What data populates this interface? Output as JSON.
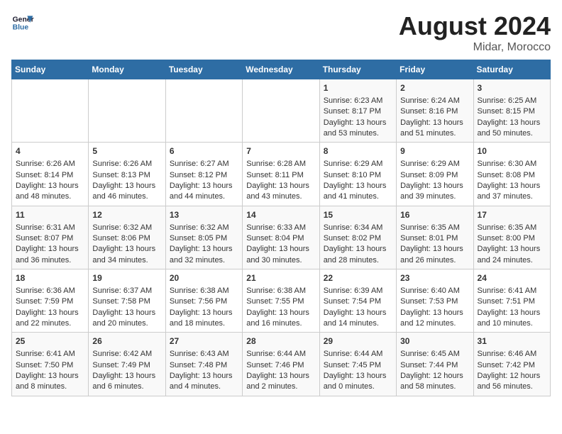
{
  "header": {
    "logo_line1": "General",
    "logo_line2": "Blue",
    "month_year": "August 2024",
    "location": "Midar, Morocco"
  },
  "days_of_week": [
    "Sunday",
    "Monday",
    "Tuesday",
    "Wednesday",
    "Thursday",
    "Friday",
    "Saturday"
  ],
  "weeks": [
    [
      {
        "day": "",
        "info": ""
      },
      {
        "day": "",
        "info": ""
      },
      {
        "day": "",
        "info": ""
      },
      {
        "day": "",
        "info": ""
      },
      {
        "day": "1",
        "info": "Sunrise: 6:23 AM\nSunset: 8:17 PM\nDaylight: 13 hours\nand 53 minutes."
      },
      {
        "day": "2",
        "info": "Sunrise: 6:24 AM\nSunset: 8:16 PM\nDaylight: 13 hours\nand 51 minutes."
      },
      {
        "day": "3",
        "info": "Sunrise: 6:25 AM\nSunset: 8:15 PM\nDaylight: 13 hours\nand 50 minutes."
      }
    ],
    [
      {
        "day": "4",
        "info": "Sunrise: 6:26 AM\nSunset: 8:14 PM\nDaylight: 13 hours\nand 48 minutes."
      },
      {
        "day": "5",
        "info": "Sunrise: 6:26 AM\nSunset: 8:13 PM\nDaylight: 13 hours\nand 46 minutes."
      },
      {
        "day": "6",
        "info": "Sunrise: 6:27 AM\nSunset: 8:12 PM\nDaylight: 13 hours\nand 44 minutes."
      },
      {
        "day": "7",
        "info": "Sunrise: 6:28 AM\nSunset: 8:11 PM\nDaylight: 13 hours\nand 43 minutes."
      },
      {
        "day": "8",
        "info": "Sunrise: 6:29 AM\nSunset: 8:10 PM\nDaylight: 13 hours\nand 41 minutes."
      },
      {
        "day": "9",
        "info": "Sunrise: 6:29 AM\nSunset: 8:09 PM\nDaylight: 13 hours\nand 39 minutes."
      },
      {
        "day": "10",
        "info": "Sunrise: 6:30 AM\nSunset: 8:08 PM\nDaylight: 13 hours\nand 37 minutes."
      }
    ],
    [
      {
        "day": "11",
        "info": "Sunrise: 6:31 AM\nSunset: 8:07 PM\nDaylight: 13 hours\nand 36 minutes."
      },
      {
        "day": "12",
        "info": "Sunrise: 6:32 AM\nSunset: 8:06 PM\nDaylight: 13 hours\nand 34 minutes."
      },
      {
        "day": "13",
        "info": "Sunrise: 6:32 AM\nSunset: 8:05 PM\nDaylight: 13 hours\nand 32 minutes."
      },
      {
        "day": "14",
        "info": "Sunrise: 6:33 AM\nSunset: 8:04 PM\nDaylight: 13 hours\nand 30 minutes."
      },
      {
        "day": "15",
        "info": "Sunrise: 6:34 AM\nSunset: 8:02 PM\nDaylight: 13 hours\nand 28 minutes."
      },
      {
        "day": "16",
        "info": "Sunrise: 6:35 AM\nSunset: 8:01 PM\nDaylight: 13 hours\nand 26 minutes."
      },
      {
        "day": "17",
        "info": "Sunrise: 6:35 AM\nSunset: 8:00 PM\nDaylight: 13 hours\nand 24 minutes."
      }
    ],
    [
      {
        "day": "18",
        "info": "Sunrise: 6:36 AM\nSunset: 7:59 PM\nDaylight: 13 hours\nand 22 minutes."
      },
      {
        "day": "19",
        "info": "Sunrise: 6:37 AM\nSunset: 7:58 PM\nDaylight: 13 hours\nand 20 minutes."
      },
      {
        "day": "20",
        "info": "Sunrise: 6:38 AM\nSunset: 7:56 PM\nDaylight: 13 hours\nand 18 minutes."
      },
      {
        "day": "21",
        "info": "Sunrise: 6:38 AM\nSunset: 7:55 PM\nDaylight: 13 hours\nand 16 minutes."
      },
      {
        "day": "22",
        "info": "Sunrise: 6:39 AM\nSunset: 7:54 PM\nDaylight: 13 hours\nand 14 minutes."
      },
      {
        "day": "23",
        "info": "Sunrise: 6:40 AM\nSunset: 7:53 PM\nDaylight: 13 hours\nand 12 minutes."
      },
      {
        "day": "24",
        "info": "Sunrise: 6:41 AM\nSunset: 7:51 PM\nDaylight: 13 hours\nand 10 minutes."
      }
    ],
    [
      {
        "day": "25",
        "info": "Sunrise: 6:41 AM\nSunset: 7:50 PM\nDaylight: 13 hours\nand 8 minutes."
      },
      {
        "day": "26",
        "info": "Sunrise: 6:42 AM\nSunset: 7:49 PM\nDaylight: 13 hours\nand 6 minutes."
      },
      {
        "day": "27",
        "info": "Sunrise: 6:43 AM\nSunset: 7:48 PM\nDaylight: 13 hours\nand 4 minutes."
      },
      {
        "day": "28",
        "info": "Sunrise: 6:44 AM\nSunset: 7:46 PM\nDaylight: 13 hours\nand 2 minutes."
      },
      {
        "day": "29",
        "info": "Sunrise: 6:44 AM\nSunset: 7:45 PM\nDaylight: 13 hours\nand 0 minutes."
      },
      {
        "day": "30",
        "info": "Sunrise: 6:45 AM\nSunset: 7:44 PM\nDaylight: 12 hours\nand 58 minutes."
      },
      {
        "day": "31",
        "info": "Sunrise: 6:46 AM\nSunset: 7:42 PM\nDaylight: 12 hours\nand 56 minutes."
      }
    ]
  ]
}
